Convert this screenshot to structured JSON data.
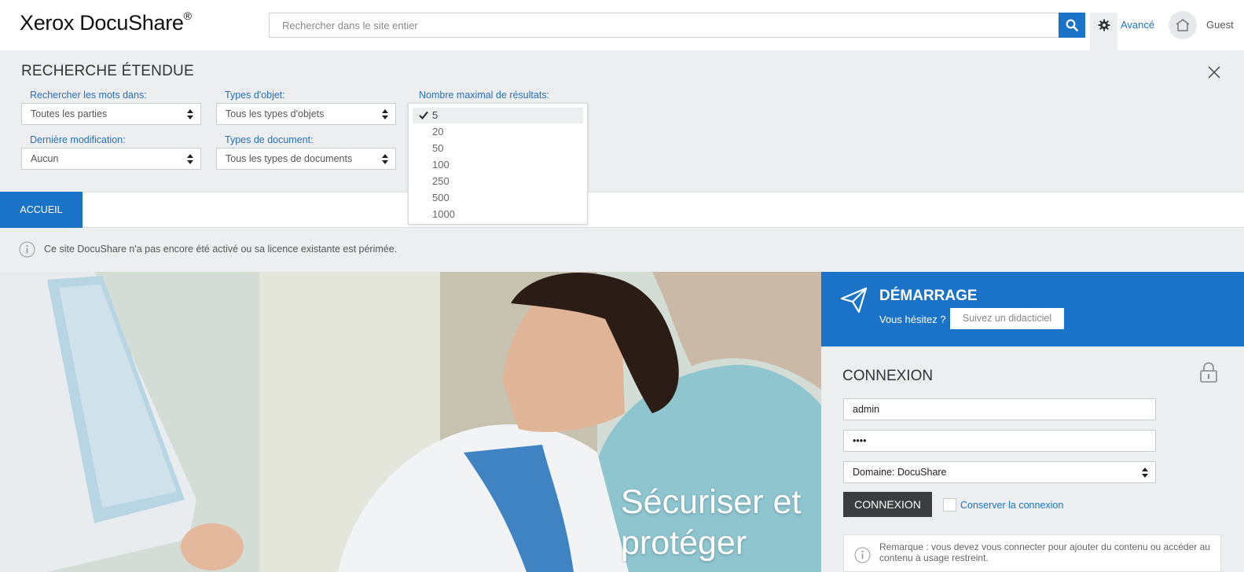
{
  "header": {
    "logo": "Xerox DocuShare",
    "logo_mark": "®",
    "search_placeholder": "Rechercher dans le site entier",
    "advanced_label": "Avancé",
    "user_label": "Guest"
  },
  "advanced_search": {
    "title": "RECHERCHE ÉTENDUE",
    "fields": {
      "words_in": {
        "label": "Rechercher les mots dans:",
        "value": "Toutes les parties"
      },
      "object_types": {
        "label": "Types d'objet:",
        "value": "Tous les types d'objets"
      },
      "max_results": {
        "label": "Nombre maximal de résultats:",
        "value": "5"
      },
      "last_modified": {
        "label": "Dernière modification:",
        "value": "Aucun"
      },
      "document_types": {
        "label": "Types de document:",
        "value": "Tous les types de documents"
      }
    },
    "max_results_options": [
      "5",
      "20",
      "50",
      "100",
      "250",
      "500",
      "1000"
    ]
  },
  "nav": {
    "tabs": [
      {
        "label": "ACCUEIL",
        "active": true
      }
    ]
  },
  "notice": {
    "text": "Ce site DocuShare n'a pas encore été activé ou sa licence existante est périmée."
  },
  "hero": {
    "line1": "Sécuriser et",
    "line2": "protéger"
  },
  "getting_started": {
    "title": "DÉMARRAGE",
    "question": "Vous hésitez ?",
    "button": "Suivez un didacticiel"
  },
  "login": {
    "title": "CONNEXION",
    "username": "admin",
    "password": "••••",
    "domain": "Domaine: DocuShare",
    "submit": "CONNEXION",
    "remember": "Conserver la connexion",
    "note": "Remarque : vous devez vous connecter pour ajouter du contenu ou accéder au contenu à usage restreint."
  },
  "colors": {
    "accent": "#1a73c7",
    "panel_bg": "#eceef0",
    "dark_button": "#3a3d40"
  }
}
